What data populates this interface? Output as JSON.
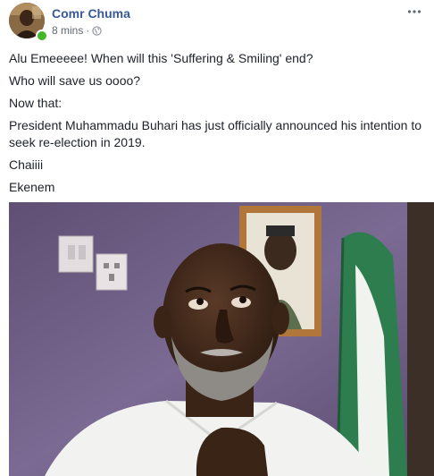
{
  "post": {
    "author": "Comr Chuma",
    "time": "8 mins",
    "separator": "·",
    "paragraphs": [
      "Alu Emeeeee! When will this 'Suffering & Smiling' end?",
      "Who will save us oooo?",
      "Now that:",
      "President Muhammadu Buhari has just officially announced his intention to seek re-election in 2019.",
      "Chaiiii",
      "Ekenem"
    ]
  },
  "icons": {
    "privacy": "globe-icon",
    "options": "more-icon",
    "presence": "online-status-icon"
  },
  "colors": {
    "author_link": "#385898",
    "text": "#1d2129",
    "meta": "#616770",
    "online": "#42b72a",
    "wall": "#6a5a7e",
    "flag_green": "#2e7d4f"
  }
}
